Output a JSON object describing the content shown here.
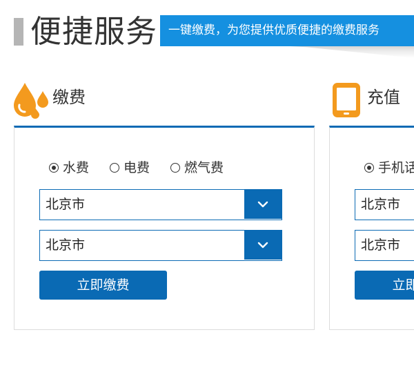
{
  "header": {
    "title": "便捷服务",
    "banner_text": "一键缴费，为您提供优质便捷的缴费服务"
  },
  "colors": {
    "primary": "#0a6ab4",
    "banner": "#1590e0",
    "accent_orange": "#f39a1e",
    "text": "#333333",
    "header_bar": "#b5b5b5"
  },
  "payment": {
    "title": "缴费",
    "icon": "water-drops-icon",
    "options": [
      {
        "label": "水费",
        "checked": true
      },
      {
        "label": "电费",
        "checked": false
      },
      {
        "label": "燃气费",
        "checked": false
      }
    ],
    "city_select": {
      "value": "北京市"
    },
    "company_select": {
      "value": "北京市"
    },
    "submit_label": "立即缴费"
  },
  "recharge": {
    "title": "充值",
    "icon": "mobile-phone-icon",
    "options": [
      {
        "label": "手机话费",
        "checked": true
      }
    ],
    "province_select": {
      "value": "北京市"
    },
    "city_select": {
      "value": "北京市"
    },
    "submit_label": "立即充值"
  }
}
